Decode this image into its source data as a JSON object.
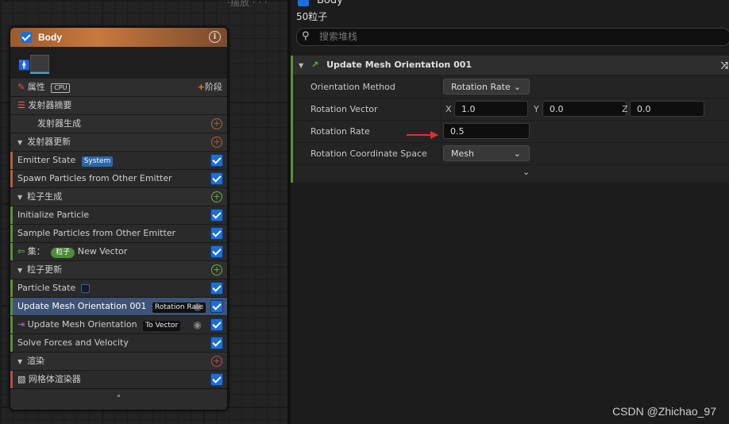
{
  "graph": {
    "top_text": "·描放 · · ·"
  },
  "node": {
    "title": "Body",
    "stage_label": "阶段",
    "props_label": "属性",
    "cpu_badge": "CPU",
    "emitter_summary": "发射器摘要",
    "emitter_spawn": "发射器生成",
    "emitter_update": "发射器更新",
    "emitter_state": "Emitter State",
    "system_badge": "System",
    "spawn_from_other": "Spawn Particles from Other Emitter",
    "particle_spawn": "粒子生成",
    "initialize_particle": "Initialize Particle",
    "sample_from_other": "Sample Particles from Other Emitter",
    "set_label": "集：",
    "particle_badge": "粒子",
    "new_vector": "New Vector",
    "particle_update": "粒子更新",
    "particle_state": "Particle State",
    "update_mesh_001": "Update Mesh Orientation 001",
    "rotation_rate_badge": "Rotation Rate",
    "update_mesh": "Update Mesh Orientation",
    "to_vector_badge": "To Vector",
    "solve_forces": "Solve Forces and Velocity",
    "render": "渲染",
    "mesh_renderer": "网格体渲染器"
  },
  "panel": {
    "body_label": "Body",
    "particles_count": "50粒子",
    "search_placeholder": "搜索堆栈",
    "module_title": "Update Mesh Orientation 001",
    "orientation_method_label": "Orientation Method",
    "orientation_method_value": "Rotation Rate",
    "rotation_vector_label": "Rotation Vector",
    "rv_x_label": "X",
    "rv_x": "1.0",
    "rv_y_label": "Y",
    "rv_y": "0.0",
    "rv_z_label": "Z",
    "rv_z": "0.0",
    "rotation_rate_label": "Rotation Rate",
    "rotation_rate_value": "0.5",
    "coord_space_label": "Rotation Coordinate Space",
    "coord_space_value": "Mesh"
  },
  "watermark": "CSDN @Zhichao_97",
  "colors": {
    "accent_blue": "#1d6fd8",
    "header_orange": "#c8793d",
    "selected_row": "#3e5376",
    "module_green": "#5c8f38",
    "arrow_red": "#e0302a"
  }
}
